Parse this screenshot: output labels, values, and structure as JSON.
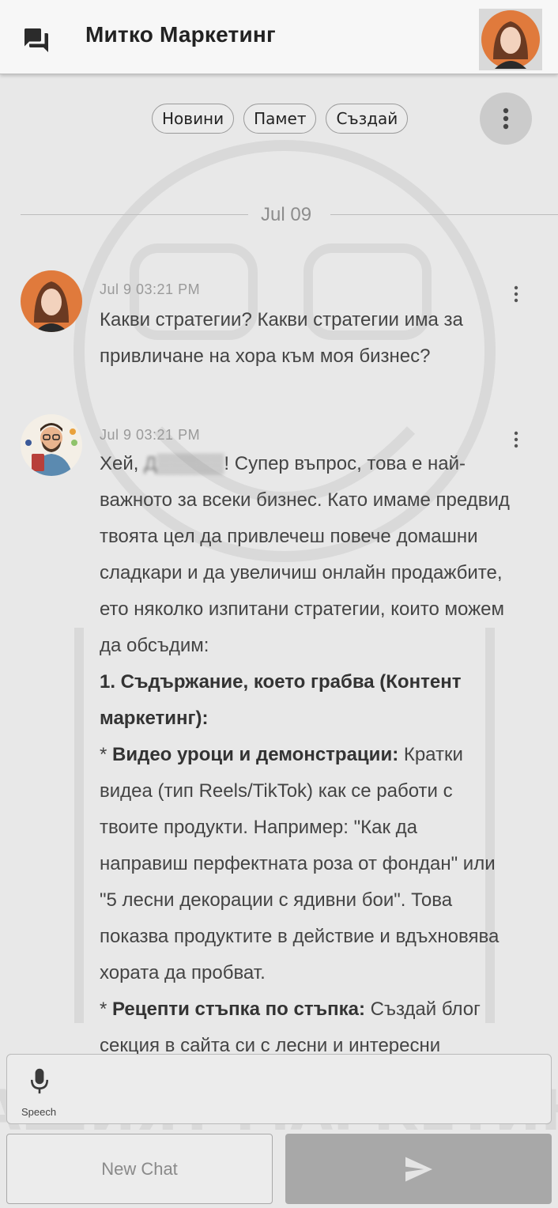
{
  "header": {
    "title": "Митко Маркетинг"
  },
  "chips": [
    {
      "label": "Новини"
    },
    {
      "label": "Памет"
    },
    {
      "label": "Създай"
    }
  ],
  "date_separator": "Jul 09",
  "messages": [
    {
      "sender": "user",
      "time": "Jul 9 03:21 PM",
      "lines": [
        "Какви стратегии? Какви стратегии има за",
        "привличане на хора към моя бизнес?"
      ]
    },
    {
      "sender": "assistant",
      "time": "Jul 9 03:21 PM",
      "greeting_pre": "Хей, ",
      "greeting_name": "Д",
      "greeting_post": "! Супер въпрос, това е най-",
      "lines": [
        "важното за всеки бизнес. Като имаме предвид",
        "твоята цел да привлечеш повече домашни",
        "сладкари и да увеличиш онлайн продажбите,",
        "ето няколко изпитани стратегии, които можем",
        "да обсъдим:"
      ],
      "section1_title_a": "1. Съдържание, което грабва (Контент",
      "section1_title_b": "маркетинг):",
      "bullet1_bold": "Видео уроци и демонстрации:",
      "bullet1_first": " Кратки",
      "bullet1_lines": [
        "видеа (тип Reels/TikTok) как се работи с",
        "твоите продукти. Например: \"Как да",
        "направиш перфектната роза от фондан\" или",
        "\"5 лесни декорации с ядивни бои\". Това",
        "показва продуктите в действие и вдъхновява",
        "хората да пробват."
      ],
      "bullet2_bold": "Рецепти стъпка по стъпка:",
      "bullet2_first": " Създай блог",
      "bullet2_lines": [
        "секция в сайта си с лесни и интересни"
      ]
    }
  ],
  "input": {
    "speech_label": "Speech"
  },
  "buttons": {
    "new_chat": "New Chat"
  },
  "watermark_text": "ВАШИЯТ МАРКЕТИНГ"
}
